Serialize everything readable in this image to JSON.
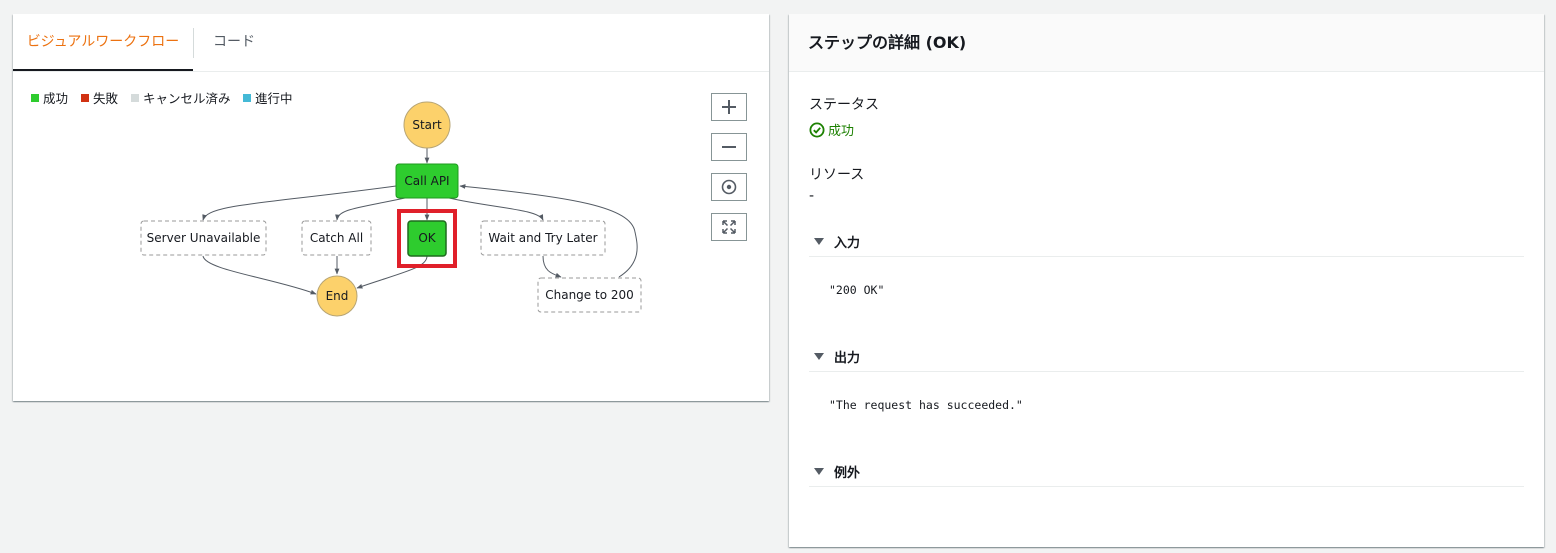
{
  "tabs": {
    "visual": "ビジュアルワークフロー",
    "code": "コード"
  },
  "legend": [
    {
      "label": "成功",
      "color": "#2ecc2e"
    },
    {
      "label": "失敗",
      "color": "#d13212"
    },
    {
      "label": "キャンセル済み",
      "color": "#d5dbdb"
    },
    {
      "label": "進行中",
      "color": "#44b9d6"
    }
  ],
  "zoom_controls": {
    "zoom_in_icon": "plus-icon",
    "zoom_out_icon": "minus-icon",
    "center_icon": "target-icon",
    "fit_icon": "expand-icon"
  },
  "graph": {
    "start": "Start",
    "call_api": "Call API",
    "server_unavailable": "Server Unavailable",
    "catch_all": "Catch All",
    "ok": "OK",
    "wait_and_try_later": "Wait and Try Later",
    "change_to_200": "Change to 200",
    "end": "End"
  },
  "details": {
    "title": "ステップの詳細 (OK)",
    "status_label": "ステータス",
    "status_value": "成功",
    "resource_label": "リソース",
    "resource_value": "-",
    "input_label": "入力",
    "input_value": "\"200 OK\"",
    "output_label": "出力",
    "output_value": "\"The request has succeeded.\"",
    "exception_label": "例外"
  },
  "colors": {
    "accent": "#ec7211",
    "success": "#2ecc2e",
    "terminal": "#fcd16b",
    "highlight": "#e0202a"
  }
}
